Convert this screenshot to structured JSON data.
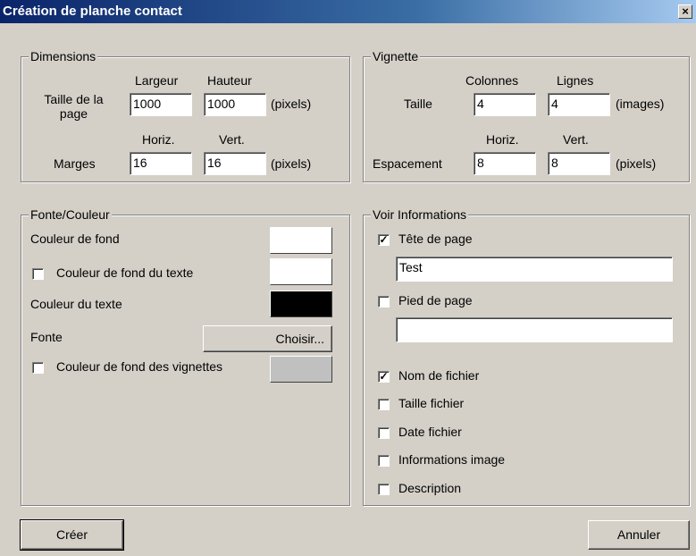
{
  "window": {
    "title": "Création de planche contact",
    "close": "×"
  },
  "dimensions": {
    "legend": "Dimensions",
    "largeur_label": "Largeur",
    "hauteur_label": "Hauteur",
    "taille_label": "Taille de la page",
    "largeur_value": "1000",
    "hauteur_value": "1000",
    "unit1": "(pixels)",
    "horiz_label": "Horiz.",
    "vert_label": "Vert.",
    "marges_label": "Marges",
    "horiz_value": "16",
    "vert_value": "16",
    "unit2": "(pixels)"
  },
  "vignette": {
    "legend": "Vignette",
    "colonnes_label": "Colonnes",
    "lignes_label": "Lignes",
    "taille_label": "Taille",
    "colonnes_value": "4",
    "lignes_value": "4",
    "unit1": "(images)",
    "horiz_label": "Horiz.",
    "vert_label": "Vert.",
    "espacement_label": "Espacement",
    "horiz_value": "8",
    "vert_value": "8",
    "unit2": "(pixels)"
  },
  "fonte": {
    "legend": "Fonte/Couleur",
    "couleur_fond_label": "Couleur de fond",
    "couleur_fond_color": "#ffffff",
    "fond_texte_label": "Couleur de fond du texte",
    "fond_texte_checked": false,
    "fond_texte_color": "#ffffff",
    "couleur_texte_label": "Couleur du texte",
    "couleur_texte_color": "#000000",
    "fonte_label": "Fonte",
    "choisir_label": "Choisir...",
    "fond_vignettes_label": "Couleur de fond des vignettes",
    "fond_vignettes_checked": false,
    "fond_vignettes_color": "#c0c0c0"
  },
  "infos": {
    "legend": "Voir Informations",
    "tete_label": "Tête de page",
    "tete_checked": true,
    "tete_value": "Test",
    "pied_label": "Pied de page",
    "pied_checked": false,
    "pied_value": "",
    "nom_label": "Nom de fichier",
    "nom_checked": true,
    "taille_label": "Taille fichier",
    "taille_checked": false,
    "date_label": "Date fichier",
    "date_checked": false,
    "infos_label": "Informations image",
    "infos_checked": false,
    "desc_label": "Description",
    "desc_checked": false
  },
  "buttons": {
    "creer": "Créer",
    "annuler": "Annuler"
  }
}
